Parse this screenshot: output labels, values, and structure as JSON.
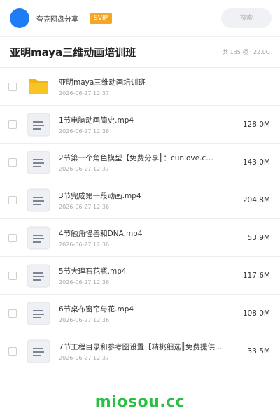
{
  "topbar": {
    "app_name": "夸克网盘分享",
    "badge": "SVIP",
    "search_placeholder": "搜索"
  },
  "header": {
    "title": "亚明maya三维动画培训班",
    "summary": "共 135 项 · 22.0G"
  },
  "items": [
    {
      "type": "folder",
      "name": "亚明maya三维动画培训班",
      "date": "2026-06-27 12:37",
      "size": ""
    },
    {
      "type": "file",
      "name": "1节电脑动画简史.mp4",
      "date": "2026-06-27 12:36",
      "size": "128.0M"
    },
    {
      "type": "file",
      "name": "2节第一个角色模型【免费分享║：cunlove.c…",
      "date": "2026-06-27 12:37",
      "size": "143.0M"
    },
    {
      "type": "file",
      "name": "3节完成第一段动画.mp4",
      "date": "2026-06-27 12:36",
      "size": "204.8M"
    },
    {
      "type": "file",
      "name": "4节触角怪兽和DNA.mp4",
      "date": "2026-06-27 12:36",
      "size": "53.9M"
    },
    {
      "type": "file",
      "name": "5节大理石花瓶.mp4",
      "date": "2026-06-27 12:36",
      "size": "117.6M"
    },
    {
      "type": "file",
      "name": "6节桌布窗帘与花.mp4",
      "date": "2026-06-27 12:36",
      "size": "108.0M"
    },
    {
      "type": "file",
      "name": "7节工程目录和参考图设置【精挑细选║免费提供：cu…",
      "date": "2026-06-27 12:37",
      "size": "33.5M"
    }
  ],
  "watermark": "miosou.cc",
  "colors": {
    "avatar": "#1f7cf5",
    "badge": "#f5a623",
    "folder": "#f7c325",
    "watermark": "#2bbf43"
  }
}
